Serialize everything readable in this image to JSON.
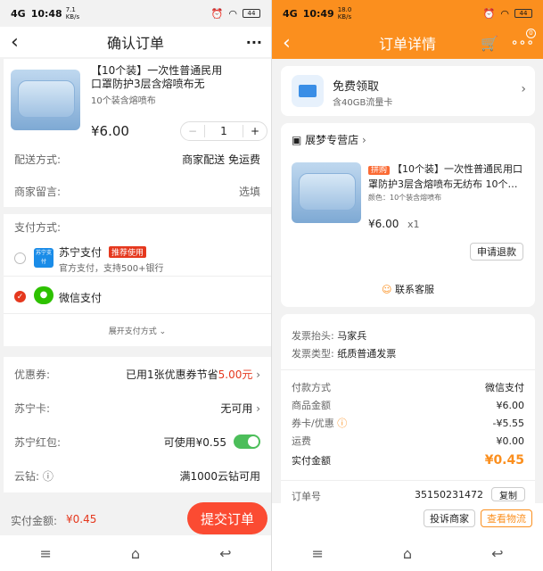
{
  "left": {
    "status": {
      "time": "10:48",
      "signal": "4G",
      "speed": "7.1 KB/s",
      "battery": "44"
    },
    "header": {
      "title": "确认订单",
      "back_icon": "‹",
      "more_icon": "···"
    },
    "product": {
      "title": "【10个装】一次性普通民用口罩防护3层含熔喷布无",
      "variant": "10个装含熔喷布",
      "price": "¥6.00",
      "quantity": "1",
      "minus": "−",
      "plus": "+"
    },
    "delivery": {
      "label": "配送方式:",
      "value": "商家配送 免运费"
    },
    "message": {
      "label": "商家留言:",
      "placeholder": "选填"
    },
    "payment": {
      "label": "支付方式:",
      "suning": {
        "logo": "苏宁支付",
        "name": "苏宁支付",
        "badge": "推荐使用",
        "desc": "官方支付，支持500+银行"
      },
      "wechat": {
        "name": "微信支付"
      },
      "expand": "展开支付方式 ⌄"
    },
    "coupon": {
      "label": "优惠券:",
      "value_prefix": "已用1张优惠券节省",
      "value_amount": "5.00元"
    },
    "card": {
      "label": "苏宁卡:",
      "value": "无可用"
    },
    "redpacket": {
      "label": "苏宁红包:",
      "value": "可使用¥0.55"
    },
    "diamond": {
      "label": "云钻:",
      "info_icon": "ⓘ",
      "value": "满1000云钻可用"
    },
    "footer": {
      "label": "实付金额:",
      "amount": "¥0.45",
      "submit": "提交订单"
    }
  },
  "right": {
    "status": {
      "time": "10:49",
      "signal": "4G",
      "speed": "18.0 KB/s",
      "battery": "44"
    },
    "header": {
      "title": "订单详情",
      "cart_badge": "0"
    },
    "promo": {
      "title": "免费领取",
      "subtitle": "含40GB流量卡"
    },
    "store": {
      "name": "展梦专营店",
      "tag": "拼购",
      "title": "【10个装】一次性普通民用口罩防护3层含熔喷布无纺布 10个…",
      "variant": "颜色：10个装含熔喷布",
      "price": "¥6.00",
      "qty": "x1",
      "refund": "申请退款",
      "service": "联系客服"
    },
    "invoice": {
      "title_label": "发票抬头:",
      "title_value": "马家兵",
      "type_label": "发票类型:",
      "type_value": "纸质普通发票"
    },
    "pay": {
      "method_label": "付款方式",
      "method_value": "微信支付",
      "goods_label": "商品金额",
      "goods_value": "¥6.00",
      "discount_label": "券卡/优惠",
      "discount_value": "-¥5.55",
      "ship_label": "运费",
      "ship_value": "¥0.00",
      "actual_label": "实付金额",
      "actual_value": "¥0.45"
    },
    "order": {
      "label": "订单号",
      "value": "35150231472",
      "copy": "复制"
    },
    "actions": {
      "complain": "投诉商家",
      "logistics": "查看物流"
    }
  }
}
